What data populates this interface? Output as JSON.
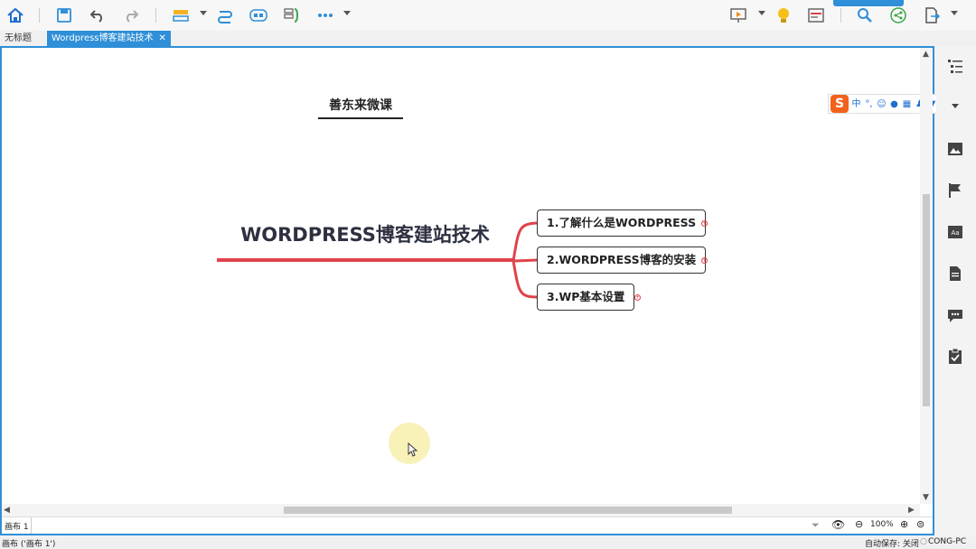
{
  "tabs": [
    {
      "label": "无标题",
      "active": false
    },
    {
      "label": "Wordpress博客建站技术",
      "active": true
    }
  ],
  "toolbar": {
    "icons": [
      "home-icon",
      "save-icon",
      "undo-icon",
      "redo-icon",
      "insert-topic-icon",
      "relationship-icon",
      "boundary-icon",
      "summary-icon",
      "more-icon",
      "presentation-icon",
      "idea-icon",
      "outline-icon",
      "search-icon",
      "share-icon",
      "export-icon"
    ]
  },
  "mindmap": {
    "floating_topic": "善东来微课",
    "central_topic": "WORDPRESS博客建站技术",
    "branches": [
      "1.了解什么是WORDPRESS",
      "2.WORDPRESS博客的安装",
      "3.WP基本设置"
    ]
  },
  "ime_bar": {
    "logo": "S",
    "mode": "中"
  },
  "status": {
    "sheet_tab": "画布 1",
    "zoom": "100%",
    "bottom_left": "画布 ('画布 1')",
    "autosave": "自动保存: 关闭",
    "user": "CONG-PC"
  },
  "right_panel": [
    "outline-icon",
    "image-icon",
    "flag-icon",
    "style-icon",
    "note-icon",
    "comment-icon",
    "task-icon"
  ],
  "colors": {
    "accent": "#2f8fd8",
    "branch_line": "#e0434a"
  }
}
